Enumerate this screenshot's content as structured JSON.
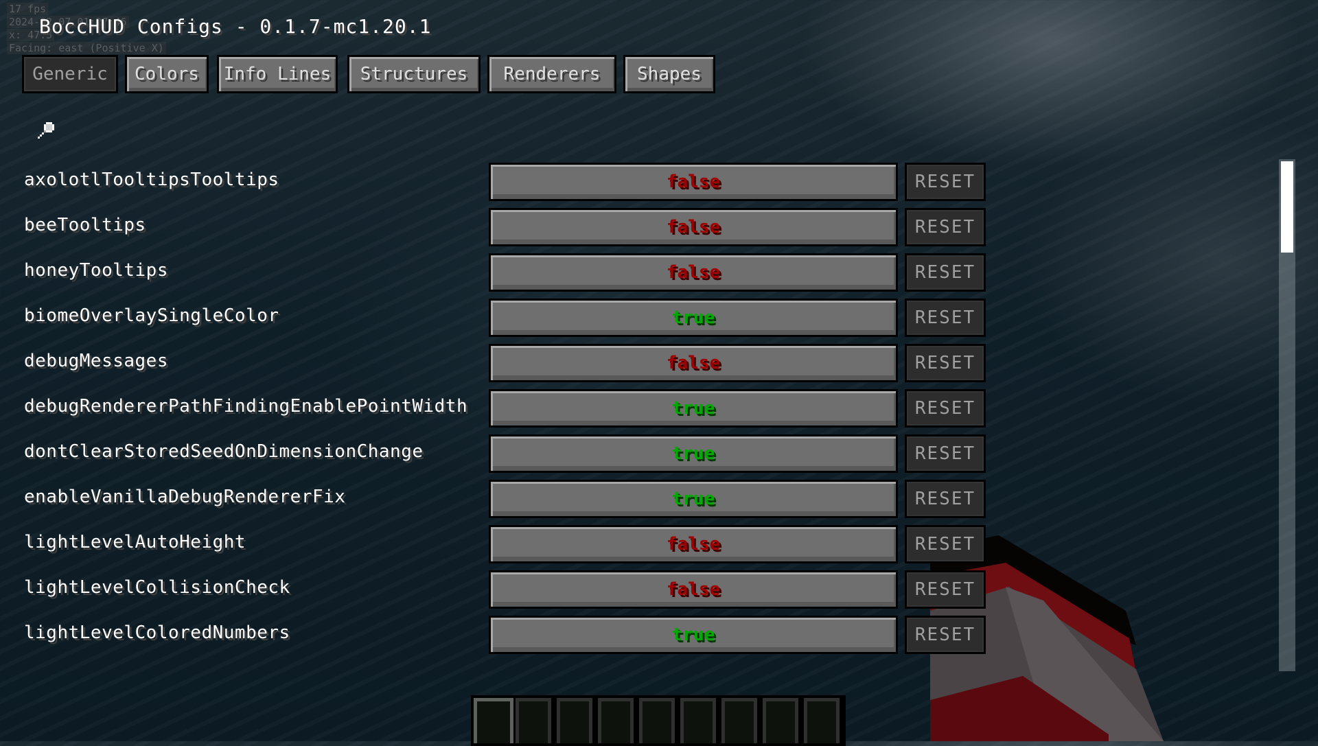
{
  "debug_overlay": {
    "fps": "17 fps",
    "datetime": "2024-02-07 01:27:46",
    "position": "x: 47.5",
    "facing": "Facing: east (Positive X)"
  },
  "header": {
    "title": "BoccHUD Configs - 0.1.7-mc1.20.1"
  },
  "tabs": [
    {
      "label": "Generic",
      "selected": true
    },
    {
      "label": "Colors",
      "selected": false
    },
    {
      "label": "Info Lines",
      "selected": false
    },
    {
      "label": "Structures",
      "selected": false
    },
    {
      "label": "Renderers",
      "selected": false
    },
    {
      "label": "Shapes",
      "selected": false
    }
  ],
  "search": {
    "icon": "magnifier-icon"
  },
  "reset_label": "RESET",
  "colors": {
    "false": "#a00000",
    "true": "#00a800"
  },
  "options": [
    {
      "name": "axolotlTooltipsTooltips",
      "value": "false"
    },
    {
      "name": "beeTooltips",
      "value": "false"
    },
    {
      "name": "honeyTooltips",
      "value": "false"
    },
    {
      "name": "biomeOverlaySingleColor",
      "value": "true"
    },
    {
      "name": "debugMessages",
      "value": "false"
    },
    {
      "name": "debugRendererPathFindingEnablePointWidth",
      "value": "true"
    },
    {
      "name": "dontClearStoredSeedOnDimensionChange",
      "value": "true"
    },
    {
      "name": "enableVanillaDebugRendererFix",
      "value": "true"
    },
    {
      "name": "lightLevelAutoHeight",
      "value": "false"
    },
    {
      "name": "lightLevelCollisionCheck",
      "value": "false"
    },
    {
      "name": "lightLevelColoredNumbers",
      "value": "true"
    }
  ],
  "scroll": {
    "position_fraction": 0.0,
    "visible_fraction": 0.18
  },
  "hotbar": {
    "slot_count": 9,
    "selected_slot": 1
  }
}
